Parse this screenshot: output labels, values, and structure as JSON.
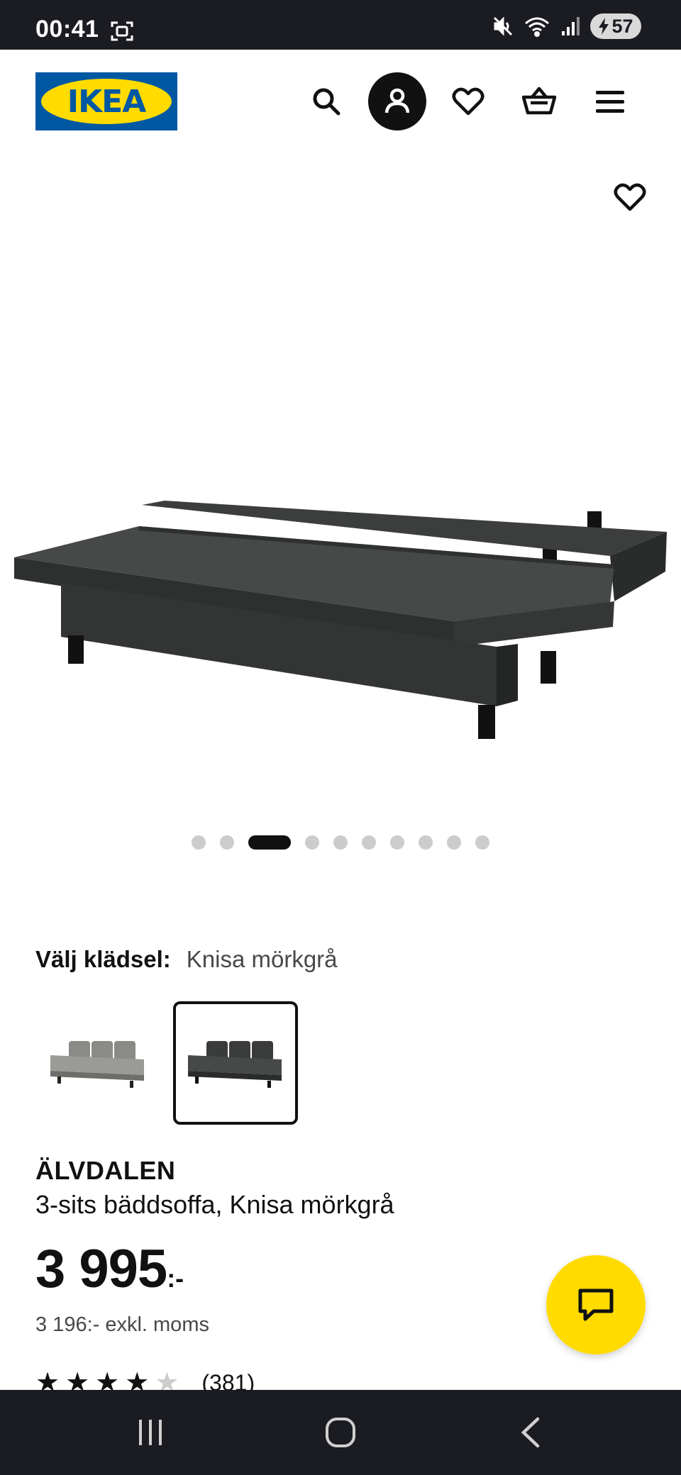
{
  "status_bar": {
    "time": "00:41",
    "battery": "57",
    "icons": [
      "screenshot-icon",
      "mute-icon",
      "wifi-icon",
      "signal-icon",
      "battery-icon"
    ]
  },
  "header": {
    "logo_text": "IKEA",
    "icons": [
      "search-icon",
      "account-icon",
      "heart-icon",
      "cart-icon",
      "menu-icon"
    ]
  },
  "gallery": {
    "image_count": 10,
    "active_index": 2,
    "favorite_icon": "heart-icon"
  },
  "variant": {
    "label": "Välj klädsel:",
    "value": "Knisa mörkgrå",
    "options": [
      {
        "name": "light-grey",
        "selected": false,
        "color": "#8a8a86"
      },
      {
        "name": "dark-grey",
        "selected": true,
        "color": "#3a3c3c"
      }
    ]
  },
  "product": {
    "name": "ÄLVDALEN",
    "description": "3-sits bäddsoffa, Knisa mörkgrå",
    "price": "3 995",
    "price_suffix": ":-",
    "price_ex_vat": "3 196:- exkl. moms",
    "rating": 4.5,
    "review_count": "(381)"
  },
  "chat": {
    "icon": "chat-icon"
  },
  "nav_bar": {
    "icons": [
      "recents-icon",
      "home-icon",
      "back-icon"
    ]
  },
  "colors": {
    "ikea_blue": "#0058a3",
    "ikea_yellow": "#ffdb00",
    "system_bar": "#1b1b22",
    "text_primary": "#111111",
    "text_secondary": "#484848"
  }
}
